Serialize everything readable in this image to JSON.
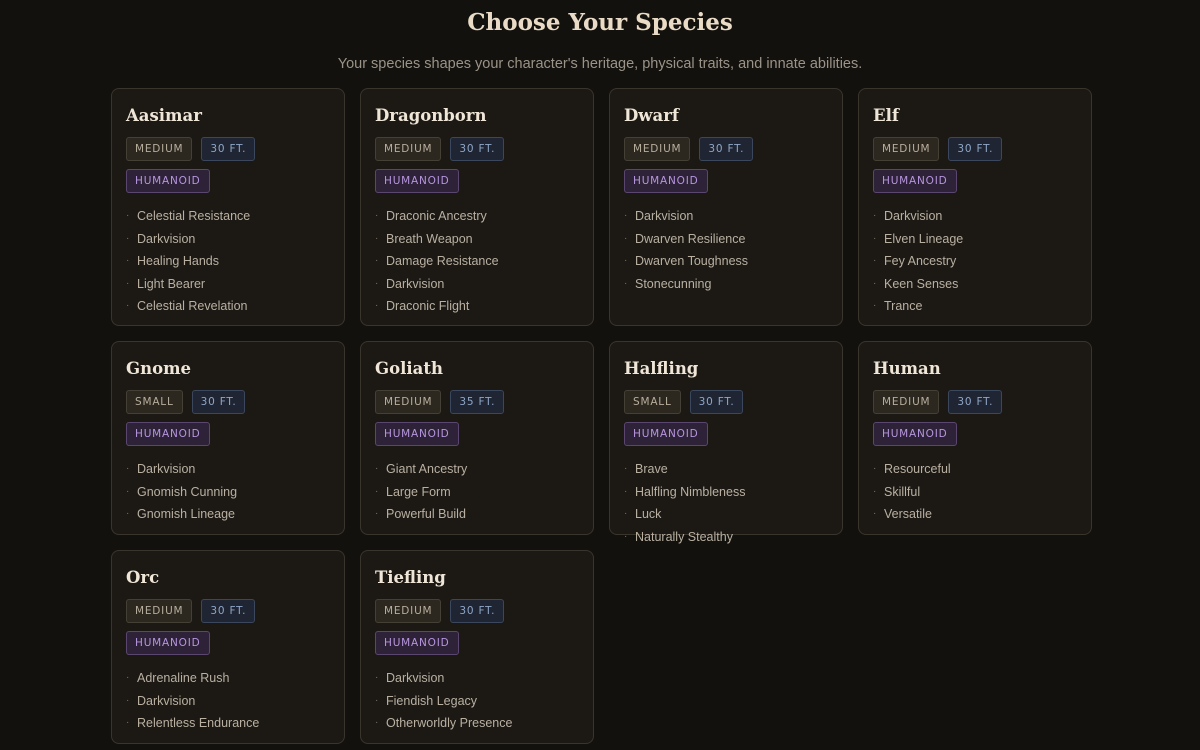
{
  "header": {
    "title": "Choose Your Species",
    "subtitle": "Your species shapes your character's heritage, physical traits, and innate abilities."
  },
  "colors": {
    "background": "#13110d",
    "card": "#1c1914",
    "card_border": "#3a352c",
    "size_tag": "#b7ad9d",
    "speed_tag": "#8fa6c8",
    "type_tag": "#b796de"
  },
  "species": [
    {
      "name": "Aasimar",
      "size": "MEDIUM",
      "speed": "30 FT.",
      "type": "HUMANOID",
      "traits": [
        "Celestial Resistance",
        "Darkvision",
        "Healing Hands",
        "Light Bearer",
        "Celestial Revelation"
      ]
    },
    {
      "name": "Dragonborn",
      "size": "MEDIUM",
      "speed": "30 FT.",
      "type": "HUMANOID",
      "traits": [
        "Draconic Ancestry",
        "Breath Weapon",
        "Damage Resistance",
        "Darkvision",
        "Draconic Flight"
      ]
    },
    {
      "name": "Dwarf",
      "size": "MEDIUM",
      "speed": "30 FT.",
      "type": "HUMANOID",
      "traits": [
        "Darkvision",
        "Dwarven Resilience",
        "Dwarven Toughness",
        "Stonecunning"
      ]
    },
    {
      "name": "Elf",
      "size": "MEDIUM",
      "speed": "30 FT.",
      "type": "HUMANOID",
      "traits": [
        "Darkvision",
        "Elven Lineage",
        "Fey Ancestry",
        "Keen Senses",
        "Trance"
      ]
    },
    {
      "name": "Gnome",
      "size": "SMALL",
      "speed": "30 FT.",
      "type": "HUMANOID",
      "traits": [
        "Darkvision",
        "Gnomish Cunning",
        "Gnomish Lineage"
      ]
    },
    {
      "name": "Goliath",
      "size": "MEDIUM",
      "speed": "35 FT.",
      "type": "HUMANOID",
      "traits": [
        "Giant Ancestry",
        "Large Form",
        "Powerful Build"
      ]
    },
    {
      "name": "Halfling",
      "size": "SMALL",
      "speed": "30 FT.",
      "type": "HUMANOID",
      "traits": [
        "Brave",
        "Halfling Nimbleness",
        "Luck",
        "Naturally Stealthy"
      ]
    },
    {
      "name": "Human",
      "size": "MEDIUM",
      "speed": "30 FT.",
      "type": "HUMANOID",
      "traits": [
        "Resourceful",
        "Skillful",
        "Versatile"
      ]
    },
    {
      "name": "Orc",
      "size": "MEDIUM",
      "speed": "30 FT.",
      "type": "HUMANOID",
      "traits": [
        "Adrenaline Rush",
        "Darkvision",
        "Relentless Endurance"
      ]
    },
    {
      "name": "Tiefling",
      "size": "MEDIUM",
      "speed": "30 FT.",
      "type": "HUMANOID",
      "traits": [
        "Darkvision",
        "Fiendish Legacy",
        "Otherworldly Presence"
      ]
    }
  ]
}
